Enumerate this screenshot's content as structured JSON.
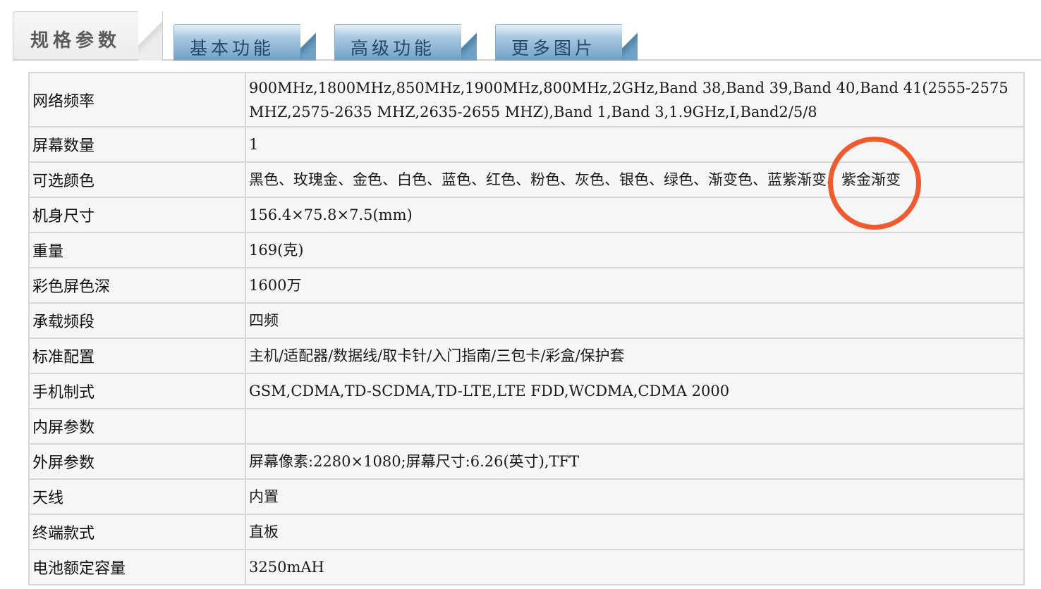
{
  "tabs": {
    "active": "规格参数",
    "items": [
      "基本功能",
      "高级功能",
      "更多图片"
    ]
  },
  "specs": [
    {
      "label": "网络频率",
      "value": "900MHz,1800MHz,850MHz,1900MHz,800MHz,2GHz,Band 38,Band 39,Band 40,Band 41(2555-2575 MHZ,2575-2635 MHZ,2635-2655 MHZ),Band 1,Band 3,1.9GHz,I,Band2/5/8"
    },
    {
      "label": "屏幕数量",
      "value": "1"
    },
    {
      "label": "可选颜色",
      "value": "黑色、玫瑰金、金色、白色、蓝色、红色、粉色、灰色、银色、绿色、渐变色、蓝紫渐变、紫金渐变"
    },
    {
      "label": "机身尺寸",
      "value": "156.4×75.8×7.5(mm)"
    },
    {
      "label": "重量",
      "value": "169(克)"
    },
    {
      "label": "彩色屏色深",
      "value": "1600万"
    },
    {
      "label": "承载频段",
      "value": "四频"
    },
    {
      "label": "标准配置",
      "value": "主机/适配器/数据线/取卡针/入门指南/三包卡/彩盒/保护套"
    },
    {
      "label": "手机制式",
      "value": "GSM,CDMA,TD-SCDMA,TD-LTE,LTE FDD,WCDMA,CDMA 2000"
    },
    {
      "label": "内屏参数",
      "value": ""
    },
    {
      "label": "外屏参数",
      "value": "屏幕像素:2280×1080;屏幕尺寸:6.26(英寸),TFT"
    },
    {
      "label": "天线",
      "value": "内置"
    },
    {
      "label": "终端款式",
      "value": "直板"
    },
    {
      "label": "电池额定容量",
      "value": "3250mAH"
    }
  ],
  "colors": {
    "annotation_circle": "#ef5a2e",
    "tab_blue": "#6fa0c6",
    "cell_background": "#f6f6f6",
    "border": "#d6d6d6"
  }
}
